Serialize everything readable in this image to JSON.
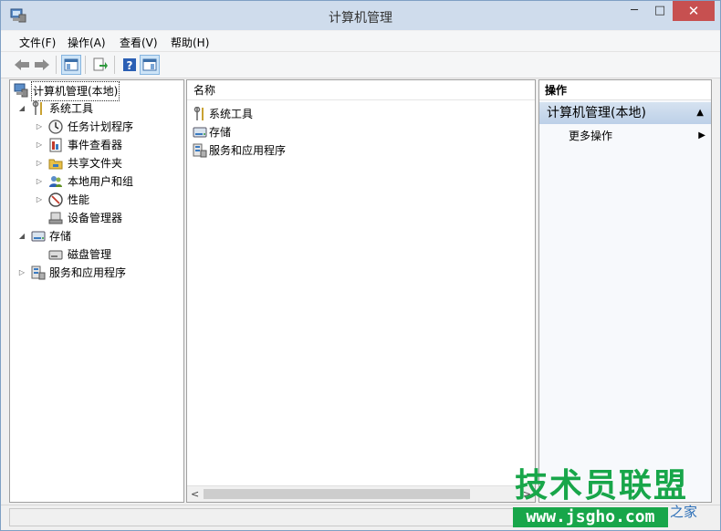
{
  "window": {
    "title": "计算机管理",
    "minimize": "─",
    "maximize": "□",
    "close": "✕"
  },
  "menu": [
    "文件(F)",
    "操作(A)",
    "查看(V)",
    "帮助(H)"
  ],
  "tree": [
    {
      "label": "计算机管理(本地)",
      "arrow": "",
      "icon": "computer-management-icon",
      "selected": true
    },
    {
      "label": "系统工具",
      "arrow": "◢",
      "icon": "system-tools-icon"
    },
    {
      "label": "任务计划程序",
      "arrow": "▷",
      "icon": "clock-icon"
    },
    {
      "label": "事件查看器",
      "arrow": "▷",
      "icon": "event-viewer-icon"
    },
    {
      "label": "共享文件夹",
      "arrow": "▷",
      "icon": "shared-folder-icon"
    },
    {
      "label": "本地用户和组",
      "arrow": "▷",
      "icon": "users-icon"
    },
    {
      "label": "性能",
      "arrow": "▷",
      "icon": "performance-icon"
    },
    {
      "label": "设备管理器",
      "arrow": "",
      "icon": "device-manager-icon"
    },
    {
      "label": "存储",
      "arrow": "◢",
      "icon": "storage-icon"
    },
    {
      "label": "磁盘管理",
      "arrow": "",
      "icon": "disk-management-icon"
    },
    {
      "label": "服务和应用程序",
      "arrow": "▷",
      "icon": "services-icon"
    }
  ],
  "list": {
    "header": "名称",
    "items": [
      {
        "label": "系统工具",
        "icon": "system-tools-icon"
      },
      {
        "label": "存储",
        "icon": "storage-icon"
      },
      {
        "label": "服务和应用程序",
        "icon": "services-icon"
      }
    ]
  },
  "actions": {
    "header": "操作",
    "section": "计算机管理(本地)",
    "section_caret": "▲",
    "item": "更多操作",
    "item_caret": "▶"
  },
  "scroll": {
    "left": "<",
    "right": ">"
  },
  "watermark": {
    "top": "技术员联盟",
    "bottom": "www.jsgho.com",
    "side": "之家"
  }
}
